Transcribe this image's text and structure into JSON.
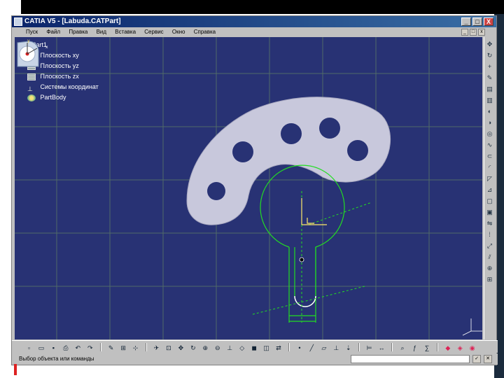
{
  "window": {
    "title": "CATIA V5 - [Labuda.CATPart]",
    "minimize": "_",
    "maximize": "□",
    "close": "X"
  },
  "menu": [
    "Пуск",
    "Файл",
    "Правка",
    "Вид",
    "Вставка",
    "Сервис",
    "Окно",
    "Справка"
  ],
  "tree": {
    "root": "Part1",
    "items": [
      "Плоскость xy",
      "Плоскость yz",
      "Плоскость zx",
      "Системы координат",
      "PartBody"
    ]
  },
  "status": {
    "message": "Выбор объекта или команды"
  },
  "sketch_color": "#22dd22",
  "part_color": "#c8c8dc",
  "viewport_color": "#283274",
  "grid_color": "#5a7a64"
}
